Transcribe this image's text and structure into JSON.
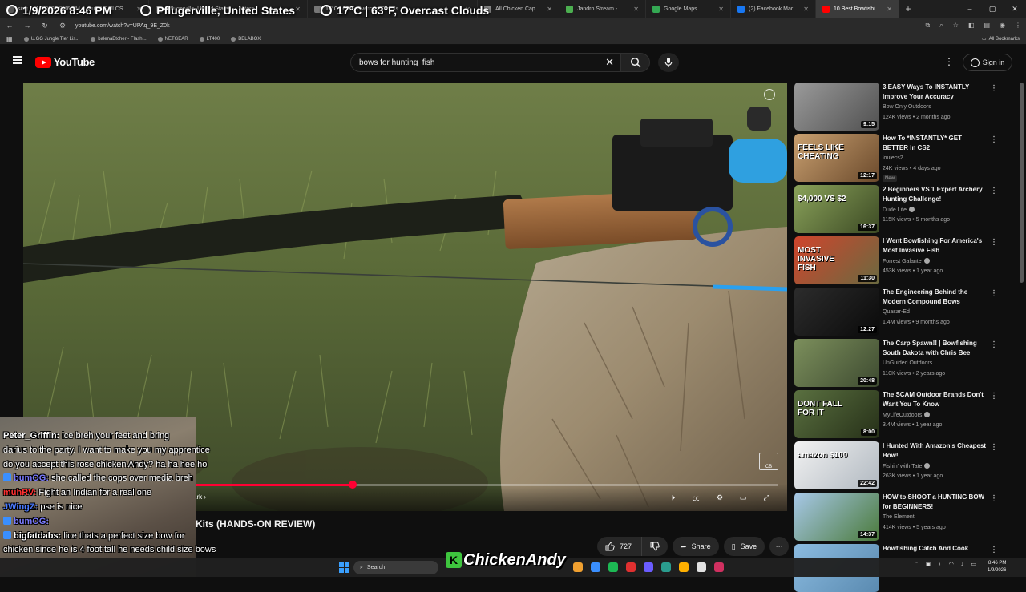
{
  "browser": {
    "tabs": [
      {
        "label": "sing ... 1/9/2026 8:46 PM ... Buy & Sell CS",
        "color": "#555555",
        "active": false
      },
      {
        "label": "Pflugerville, United States ... etitors",
        "color": "#666666",
        "active": false
      },
      {
        "label": "17°C | 63°F, Overcast Clouds",
        "color": "#777777",
        "active": false
      },
      {
        "label": "All Chicken Capsule Sticke...",
        "color": "#888888",
        "active": false
      },
      {
        "label": "Jandro Stream - Watch Li...",
        "color": "#4caf50",
        "active": false
      },
      {
        "label": "Google Maps",
        "color": "#34a853",
        "active": false
      },
      {
        "label": "(2) Facebook Marketplace",
        "color": "#1877f2",
        "active": false
      },
      {
        "label": "10 Best Bowfishing B...",
        "color": "#ff0000",
        "active": true
      }
    ],
    "new_tab": "+",
    "window_controls": [
      "–",
      "▢",
      "✕"
    ],
    "url": "youtube.com/watch?v=UPAq_9E_Z0k",
    "bookmarks": [
      "U.GG Jungle Tier Lis...",
      "balenaEtcher - Flash...",
      "NETGEAR",
      "LT400",
      "BELABOX"
    ],
    "all_bookmarks": "All Bookmarks"
  },
  "overlay": {
    "datetime": "1/9/2026 8:46 PM",
    "location": "Pflugerville, United States",
    "weather": "17°C | 63°F, Overcast Clouds"
  },
  "youtube": {
    "logo_text": "YouTube",
    "search_query": "bows for hunting  fish",
    "signin": "Sign in",
    "more_icon": "⋮"
  },
  "player": {
    "progress": 0.43,
    "chapter_label": "ark ›",
    "corner_badge": "CB"
  },
  "video": {
    "title_visible": "Kits (HANDS-ON REVIEW)",
    "likes": "727",
    "share_label": "Share",
    "save_label": "Save"
  },
  "recommendations": [
    {
      "title": "3 EASY Ways To INSTANTLY Improve Your Accuracy",
      "channel": "Bow Only Outdoors",
      "verified": false,
      "meta": "124K views • 2 months ago",
      "duration": "9:15",
      "badge": "",
      "thumb_bg": "linear-gradient(135deg,#9a9a9a,#505050)",
      "thumb_text": ""
    },
    {
      "title": "How To *INSTANTLY* GET BETTER In CS2",
      "channel": "louiecs2",
      "verified": false,
      "meta": "24K views • 4 days ago",
      "duration": "12:17",
      "badge": "New",
      "thumb_bg": "linear-gradient(135deg,#c9a070,#6b4a2c)",
      "thumb_text": "FEELS LIKE CHEATING"
    },
    {
      "title": "2 Beginners VS 1 Expert Archery Hunting Challenge!",
      "channel": "Dude Life",
      "verified": true,
      "meta": "115K views • 5 months ago",
      "duration": "16:37",
      "badge": "",
      "thumb_bg": "linear-gradient(135deg,#8aa25a,#3c4a24)",
      "thumb_text": "$4,000 VS $2"
    },
    {
      "title": "I Went Bowfishing For America's Most Invasive Fish",
      "channel": "Forrest Galante",
      "verified": true,
      "meta": "453K views • 1 year ago",
      "duration": "11:30",
      "badge": "",
      "thumb_bg": "linear-gradient(135deg,#d0442c,#6a6a40)",
      "thumb_text": "MOST INVASIVE FISH"
    },
    {
      "title": "The Engineering Behind the Modern Compound Bows",
      "channel": "Quasar-Ed",
      "verified": false,
      "meta": "1.4M views • 9 months ago",
      "duration": "12:27",
      "badge": "",
      "thumb_bg": "linear-gradient(135deg,#2c2c2c,#0a0a0a)",
      "thumb_text": ""
    },
    {
      "title": "The Carp Spawn!! | Bowfishing South Dakota with Chris Bee",
      "channel": "UnGuided Outdoors",
      "verified": false,
      "meta": "110K views • 2 years ago",
      "duration": "20:48",
      "badge": "",
      "thumb_bg": "linear-gradient(135deg,#7c8f5c,#3d4a30)",
      "thumb_text": ""
    },
    {
      "title": "The SCAM Outdoor Brands Don't Want You To Know",
      "channel": "MyLifeOutdoors",
      "verified": true,
      "meta": "3.4M views • 1 year ago",
      "duration": "8:00",
      "badge": "",
      "thumb_bg": "linear-gradient(135deg,#5a7040,#263018)",
      "thumb_text": "DONT FALL FOR IT"
    },
    {
      "title": "I Hunted With Amazon's Cheapest Bow!",
      "channel": "Fishin' with Tate",
      "verified": true,
      "meta": "263K views • 1 year ago",
      "duration": "22:42",
      "badge": "",
      "thumb_bg": "linear-gradient(135deg,#f2f2f2,#b0b8c0)",
      "thumb_text": "amazon $100"
    },
    {
      "title": "HOW to SHOOT a HUNTING BOW for BEGINNERS!",
      "channel": "The Element",
      "verified": false,
      "meta": "414K views • 5 years ago",
      "duration": "14:37",
      "badge": "",
      "thumb_bg": "linear-gradient(135deg,#a7c8e8,#4a7a3a)",
      "thumb_text": ""
    },
    {
      "title": "Bowfishing Catch And Cook",
      "channel": "",
      "verified": false,
      "meta": "",
      "duration": "",
      "badge": "",
      "thumb_bg": "linear-gradient(135deg,#8bbbe0,#5a8ab0)",
      "thumb_text": ""
    }
  ],
  "chat": [
    {
      "user": "Peter_Griffin:",
      "user_color": "#ffffff",
      "text": "ice breh your feet and bring",
      "badge_color": ""
    },
    {
      "user": "",
      "user_color": "#ffffff",
      "text": "darius to the party. I want to make you my apprentice",
      "badge_color": ""
    },
    {
      "user": "",
      "user_color": "#ffffff",
      "text": "do you accept this rose chicken Andy? ha ha hee ho",
      "badge_color": ""
    },
    {
      "user": "bumOG:",
      "user_color": "#7a7aff",
      "text": "she called the cops over media breh",
      "badge_color": "#3a8fff"
    },
    {
      "user": "muhRV:",
      "user_color": "#ff3030",
      "text": "Fight an Indian for a real one",
      "badge_color": ""
    },
    {
      "user": "JWingZ:",
      "user_color": "#4a7aff",
      "text": "pse is nice",
      "badge_color": ""
    },
    {
      "user": "bumOG:",
      "user_color": "#7a7aff",
      "text": "",
      "badge_color": "#3a8fff"
    },
    {
      "user": "bigfatdabs:",
      "user_color": "#ffffff",
      "text": "lice thats a perfect size bow for",
      "badge_color": "#3a8fff"
    },
    {
      "user": "",
      "user_color": "#ffffff",
      "text": "chicken since he is 4 foot tall he needs child size bows",
      "badge_color": ""
    }
  ],
  "stream": {
    "brand": "ChickenAndy",
    "brand_letter": "K"
  },
  "taskbar": {
    "search": "Search",
    "time": "8:46 PM",
    "date": "1/9/2026",
    "apps": [
      "#f0a030",
      "#3a8fff",
      "#1db954",
      "#e03030",
      "#6a5cff",
      "#2a9d8f",
      "#ffb000",
      "#e2e2e2",
      "#d03060"
    ]
  },
  "colors": {
    "accent": "#ff0033",
    "yt_red": "#ff0000"
  }
}
